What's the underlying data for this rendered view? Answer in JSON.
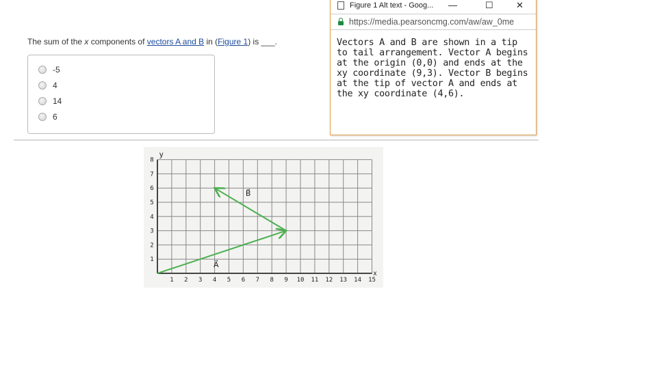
{
  "question": {
    "prefix": "The sum of the ",
    "var": "x",
    "middle": " components of ",
    "link1": "vectors A and B",
    "mid2": " in (",
    "link2": "Figure 1",
    "suffix": ") is ___."
  },
  "options": [
    "-5",
    "4",
    "14",
    "6"
  ],
  "popup": {
    "title": "Figure 1 Alt text - Goog...",
    "minimize": "—",
    "maximize": "☐",
    "close": "✕",
    "url": "https://media.pearsoncmg.com/aw/aw_0me",
    "alt_text": "Vectors A and B are shown in a tip to tail arrangement.  Vector A begins at the origin (0,0) and ends at the xy coordinate (9,3).  Vector B begins at the tip of vector A and ends at the xy coordinate (4,6)."
  },
  "chart_data": {
    "type": "line",
    "xlabel": "x",
    "ylabel": "y",
    "xlim": [
      0,
      15
    ],
    "ylim": [
      0,
      8
    ],
    "grid": true,
    "xticks": [
      "1",
      "2",
      "3",
      "4",
      "5",
      "6",
      "7",
      "8",
      "9",
      "10",
      "11",
      "12",
      "13",
      "14",
      "15"
    ],
    "yticks": [
      "1",
      "2",
      "3",
      "4",
      "5",
      "6",
      "7",
      "8"
    ],
    "series": [
      {
        "name": "A",
        "label": "A⃗",
        "from": [
          0,
          0
        ],
        "to": [
          9,
          3
        ]
      },
      {
        "name": "B",
        "label": "B⃗",
        "from": [
          9,
          3
        ],
        "to": [
          4,
          6
        ]
      }
    ],
    "color": "#4caf50"
  }
}
